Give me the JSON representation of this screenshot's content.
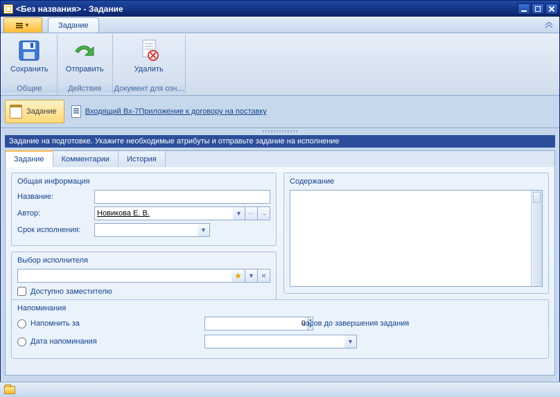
{
  "window": {
    "title": "<Без названия> - Задание"
  },
  "ribbon": {
    "tab": "Задание",
    "groups": {
      "g1": {
        "title": "Общие",
        "save": "Сохранить"
      },
      "g2": {
        "title": "Действия",
        "send": "Отправить"
      },
      "g3": {
        "title": "Документ для озн...",
        "delete": "Удалить"
      }
    }
  },
  "context": {
    "task_btn": "Задание",
    "attachment": "Входящий Вх-7Приложение к договору на поставку"
  },
  "banner": "Задание на подготовке. Укажите необходимые атрибуты и отправьте задание на исполнение",
  "tabs": {
    "t1": "Задание",
    "t2": "Комментарии",
    "t3": "История"
  },
  "general": {
    "title": "Общая информация",
    "name_label": "Название:",
    "name_value": "",
    "author_label": "Автор:",
    "author_value": "Новикова Е. В.",
    "deadline_label": "Срок исполнения:",
    "deadline_value": ""
  },
  "executor": {
    "title": "Выбор исполнителя",
    "value": "",
    "allow_deputy": "Доступно заместителю"
  },
  "content": {
    "title": "Содержание",
    "value": ""
  },
  "reminders": {
    "title": "Напоминания",
    "before_label": "Напомнить за",
    "before_value": "0",
    "before_suffix": "часов до завершения задания",
    "date_label": "Дата напоминания",
    "date_value": ""
  }
}
